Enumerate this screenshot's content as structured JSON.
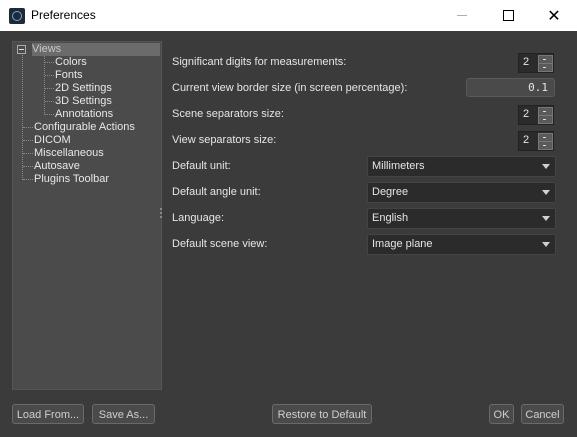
{
  "window": {
    "title": "Preferences"
  },
  "tree": {
    "items": [
      {
        "label": "Views"
      },
      {
        "label": "Colors"
      },
      {
        "label": "Fonts"
      },
      {
        "label": "2D Settings"
      },
      {
        "label": "3D Settings"
      },
      {
        "label": "Annotations"
      },
      {
        "label": "Configurable Actions"
      },
      {
        "label": "DICOM"
      },
      {
        "label": "Miscellaneous"
      },
      {
        "label": "Autosave"
      },
      {
        "label": "Plugins Toolbar"
      }
    ]
  },
  "settings": {
    "significant_digits": {
      "label": "Significant digits for measurements:",
      "value": "2"
    },
    "border_size": {
      "label": "Current view border size (in screen percentage):",
      "value": "0.1"
    },
    "scene_separators": {
      "label": "Scene separators size:",
      "value": "2"
    },
    "view_separators": {
      "label": "View separators size:",
      "value": "2"
    },
    "default_unit": {
      "label": "Default unit:",
      "value": "Millimeters"
    },
    "default_angle_unit": {
      "label": "Default angle unit:",
      "value": "Degree"
    },
    "language": {
      "label": "Language:",
      "value": "English"
    },
    "default_scene_view": {
      "label": "Default scene view:",
      "value": "Image plane"
    }
  },
  "buttons": {
    "load_from": "Load From...",
    "save_as": "Save As...",
    "restore_default": "Restore to Default",
    "ok": "OK",
    "cancel": "Cancel"
  }
}
